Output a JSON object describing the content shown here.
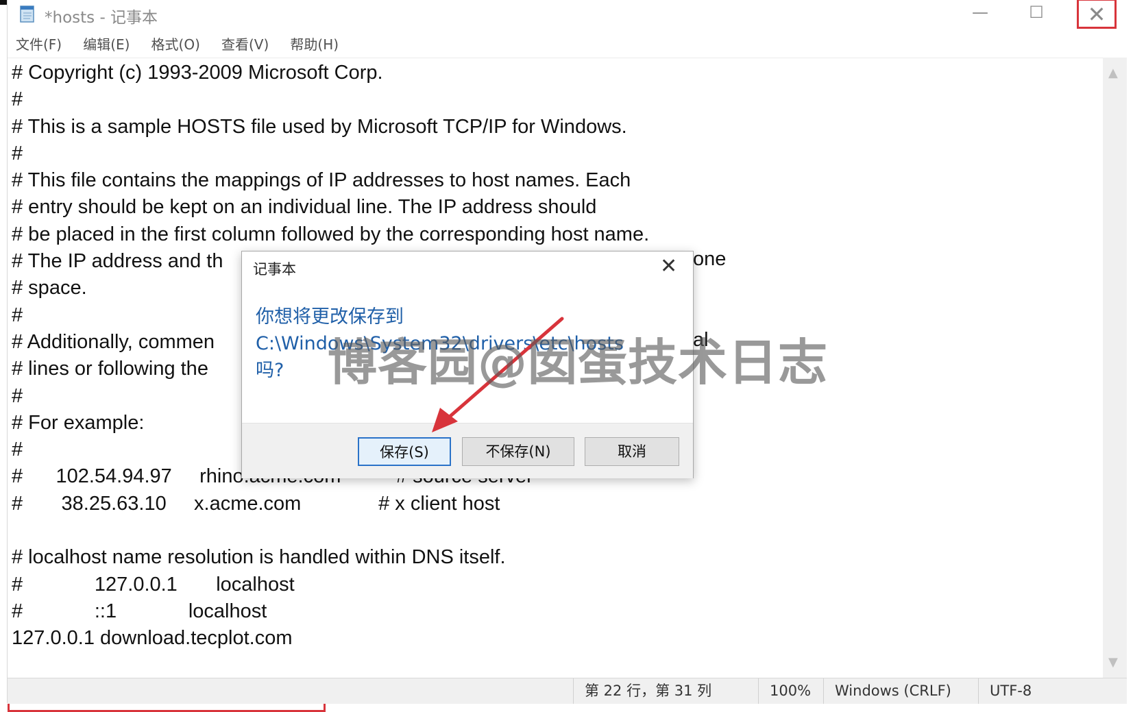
{
  "window": {
    "title": "*hosts - 记事本",
    "minimize_glyph": "—",
    "maximize_glyph": "☐",
    "close_glyph": "✕"
  },
  "menu": [
    "文件(F)",
    "编辑(E)",
    "格式(O)",
    "查看(V)",
    "帮助(H)"
  ],
  "editor": {
    "lines": [
      "# Copyright (c) 1993-2009 Microsoft Corp.",
      "#",
      "# This is a sample HOSTS file used by Microsoft TCP/IP for Windows.",
      "#",
      "# This file contains the mappings of IP addresses to host names. Each",
      "# entry should be kept on an individual line. The IP address should",
      "# be placed in the first column followed by the corresponding host name.",
      "# The IP address and th",
      "# space.",
      "#",
      "# Additionally, commen",
      "# lines or following the",
      "#",
      "# For example:",
      "#",
      "#      102.54.94.97     rhino.acme.com          # source server",
      "#       38.25.63.10     x.acme.com              # x client host",
      "",
      "# localhost name resolution is handled within DNS itself.",
      "#             127.0.0.1       localhost",
      "#             ::1             localhost",
      "127.0.0.1 download.tecplot.com"
    ],
    "partial_right_text_1": "one",
    "partial_right_text_2": "al"
  },
  "statusbar": {
    "position": "第 22 行，第 31 列",
    "zoom": "100%",
    "line_ending": "Windows (CRLF)",
    "encoding": "UTF-8"
  },
  "dialog": {
    "title": "记事本",
    "message_line1": "你想将更改保存到",
    "message_line2": "C:\\Windows\\System32\\drivers\\etc\\hosts",
    "message_line3": "吗?",
    "save_label": "保存(S)",
    "dont_save_label": "不保存(N)",
    "cancel_label": "取消",
    "close_glyph": "✕"
  },
  "watermark": "博客园@囡蛋技术日志",
  "colors": {
    "highlight_red": "#d8343b",
    "message_blue": "#1f5fa8",
    "primary_button_border": "#2a72c8"
  }
}
